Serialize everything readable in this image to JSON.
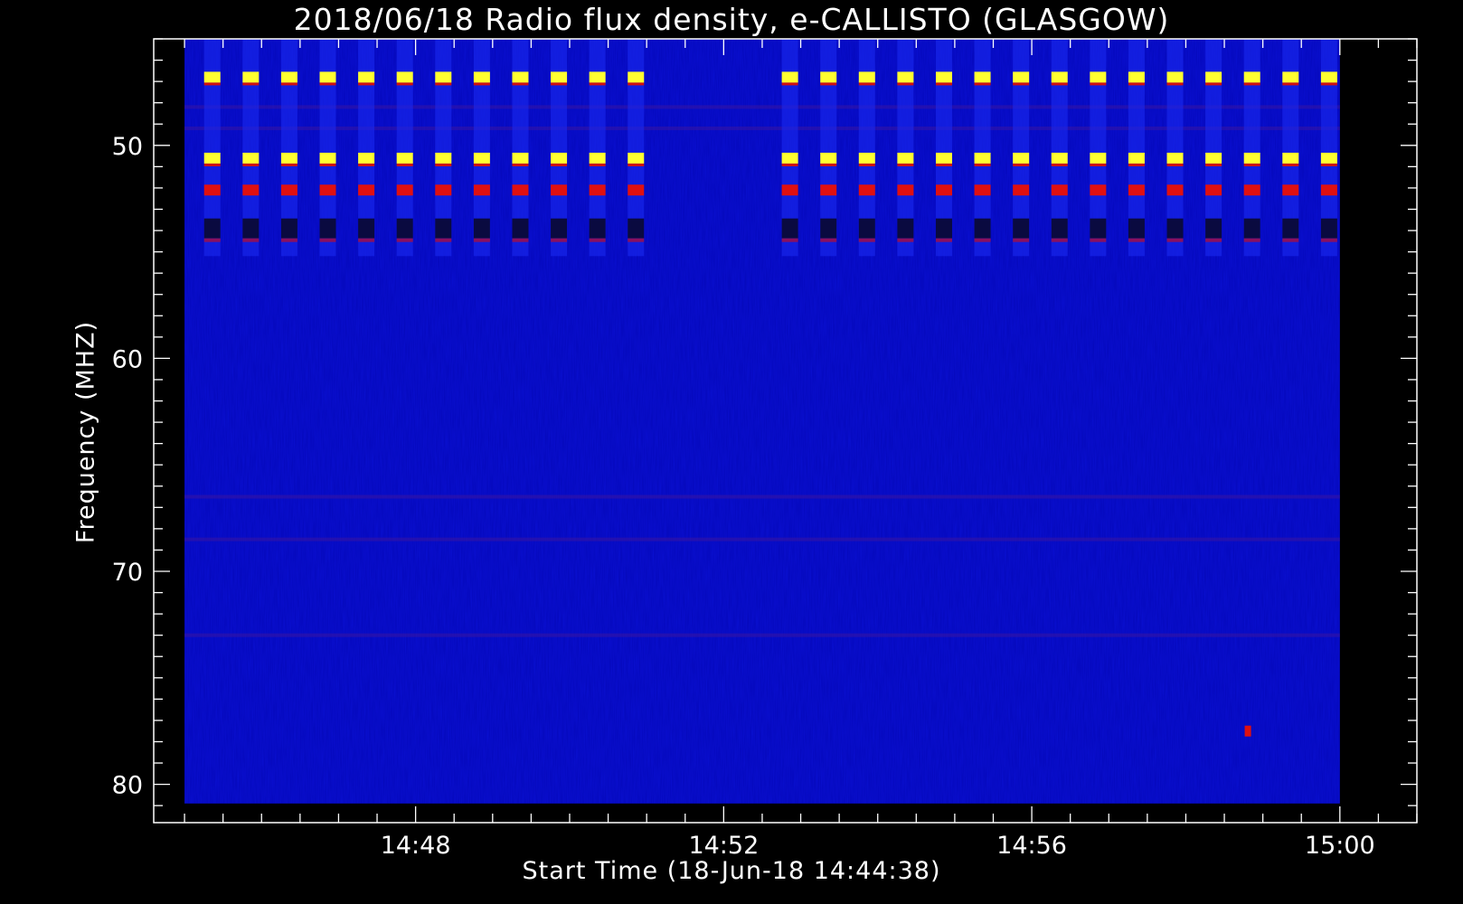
{
  "chart_data": {
    "type": "heatmap",
    "title": "2018/06/18  Radio flux density, e-CALLISTO (GLASGOW)",
    "xlabel": "Start Time (18-Jun-18 14:44:38)",
    "ylabel": "Frequency (MHZ)",
    "x_ticks": [
      {
        "label": "14:48",
        "minutes": 48
      },
      {
        "label": "14:52",
        "minutes": 52
      },
      {
        "label": "14:56",
        "minutes": 56
      },
      {
        "label": "15:00",
        "minutes": 60
      }
    ],
    "y_ticks": [
      50,
      60,
      70,
      80
    ],
    "xlim_minutes": [
      44.6,
      61.0
    ],
    "ylim_mhz": [
      45.0,
      81.8
    ],
    "data_extent": {
      "x_minutes": [
        45.0,
        60.0
      ],
      "y_mhz": [
        45.0,
        80.9
      ]
    },
    "background_level": "low (blue)",
    "colors": {
      "background": "#0a10d2",
      "strong": "#ffff30",
      "medium": "#e01010",
      "weak": "#0a0a40"
    },
    "calibration_pulses": {
      "times_minutes": [
        45.36,
        45.86,
        46.36,
        46.86,
        47.36,
        47.86,
        48.36,
        48.86,
        49.36,
        49.86,
        50.36,
        50.86,
        52.86,
        53.36,
        53.86,
        54.36,
        54.86,
        55.36,
        55.86,
        56.36,
        56.86,
        57.36,
        57.86,
        58.36,
        58.86,
        59.36,
        59.86
      ],
      "bands": [
        {
          "mhz": 46.8,
          "level": "strong"
        },
        {
          "mhz": 50.6,
          "level": "strong"
        },
        {
          "mhz": 52.1,
          "level": "medium"
        },
        {
          "mhz": 53.9,
          "level": "weak"
        }
      ]
    },
    "interference_bands_mhz": [
      48.2,
      49.2,
      66.5,
      68.5,
      73.0
    ],
    "spikes": [
      {
        "minutes": 58.8,
        "mhz": 77.5,
        "level": "medium"
      }
    ]
  }
}
